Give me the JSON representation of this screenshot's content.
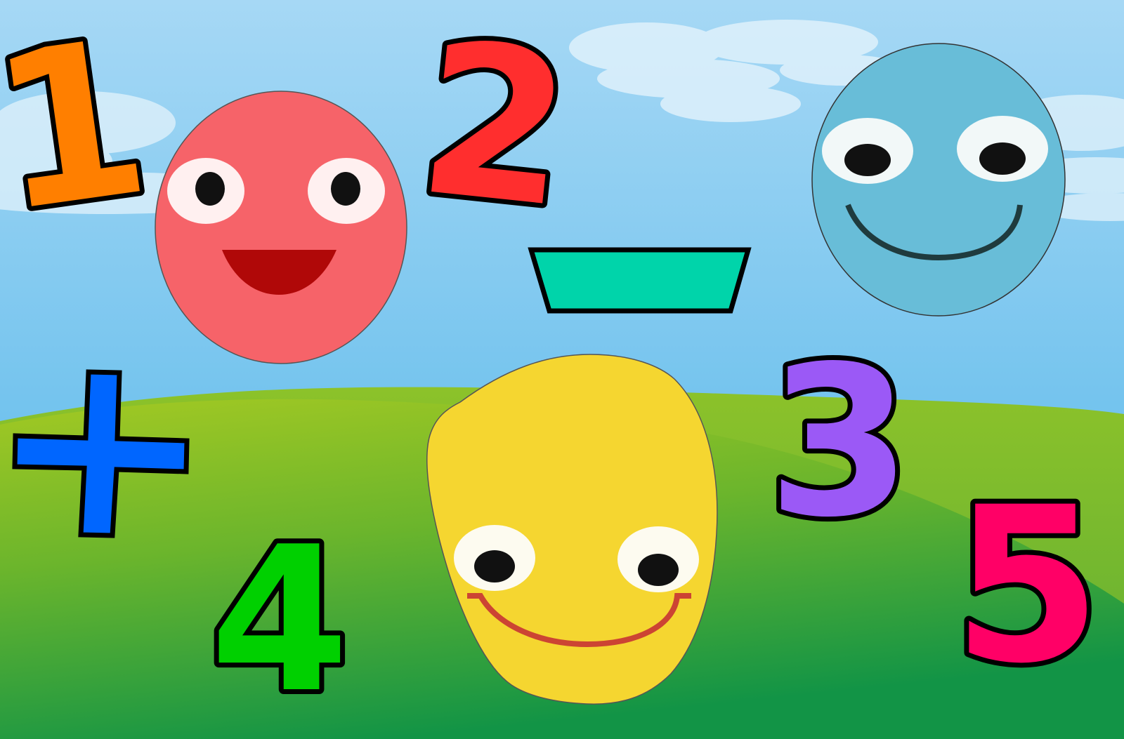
{
  "scene": {
    "sky_top_color": "#a6d8f5",
    "sky_bottom_color": "#4bb3e8",
    "grass_light_color": "#a3c923",
    "grass_dark_color": "#129446"
  },
  "numbers": [
    {
      "id": "one",
      "label": "1",
      "color": "#ff7f00"
    },
    {
      "id": "two",
      "label": "2",
      "color": "#ff2e2e"
    },
    {
      "id": "three",
      "label": "3",
      "color": "#9b59f6"
    },
    {
      "id": "four",
      "label": "4",
      "color": "#00d000"
    },
    {
      "id": "five",
      "label": "5",
      "color": "#ff0066"
    }
  ],
  "operators": [
    {
      "id": "plus",
      "name": "plus-sign",
      "color": "#0066ff"
    },
    {
      "id": "minus",
      "name": "minus-sign",
      "color": "#00d4aa"
    }
  ],
  "faces": [
    {
      "id": "red",
      "name": "red-face",
      "color": "#f66369",
      "mouth_color": "#b00808"
    },
    {
      "id": "blue",
      "name": "blue-face",
      "color": "#68bdd8",
      "mouth_color": "#1f3b3e"
    },
    {
      "id": "yellow",
      "name": "yellow-face",
      "color": "#f5d630",
      "mouth_color": "#cc4433"
    }
  ]
}
